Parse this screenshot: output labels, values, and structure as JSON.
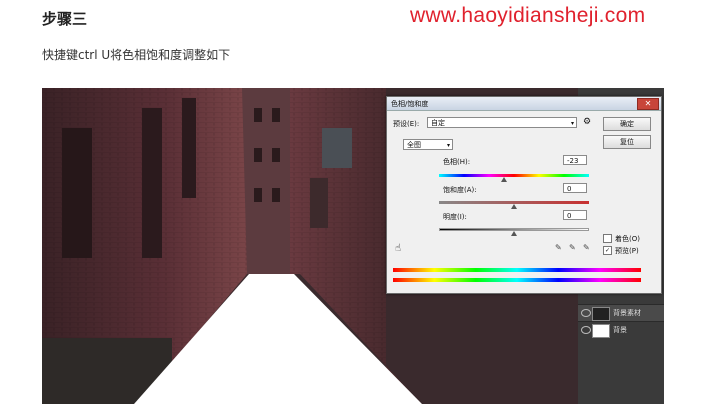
{
  "article": {
    "step_heading": "步骤三",
    "site_url": "www.haoyidiansheji.com",
    "instruction": "快捷键ctrl U将色相饱和度调整如下"
  },
  "dialog": {
    "title": "色相/饱和度",
    "close_glyph": "✕",
    "preset_label": "预设(E):",
    "preset_value": "自定",
    "channel_value": "全图",
    "hue_label": "色相(H):",
    "hue_value": "-23",
    "saturation_label": "饱和度(A):",
    "saturation_value": "0",
    "lightness_label": "明度(I):",
    "lightness_value": "0",
    "ok_label": "确定",
    "cancel_label": "复位",
    "colorize_label": "着色(O)",
    "preview_label": "预览(P)",
    "preview_checked": "✓",
    "colorize_checked": false,
    "hue_level": -23,
    "saturation_level": 0,
    "lightness_level": 0
  },
  "layers": [
    {
      "name": "背景素材"
    },
    {
      "name": "背景"
    }
  ],
  "icons": {
    "hand_tool": "hand-icon",
    "eyedropper": "eyedropper-icon",
    "settings": "gear-icon",
    "visibility": "eye-icon"
  },
  "colors": {
    "url_red": "#e0212d",
    "spectrum": [
      "#ff0000",
      "#ffff00",
      "#00ff00",
      "#00ffff",
      "#0000ff",
      "#ff00ff",
      "#ff0000"
    ]
  }
}
